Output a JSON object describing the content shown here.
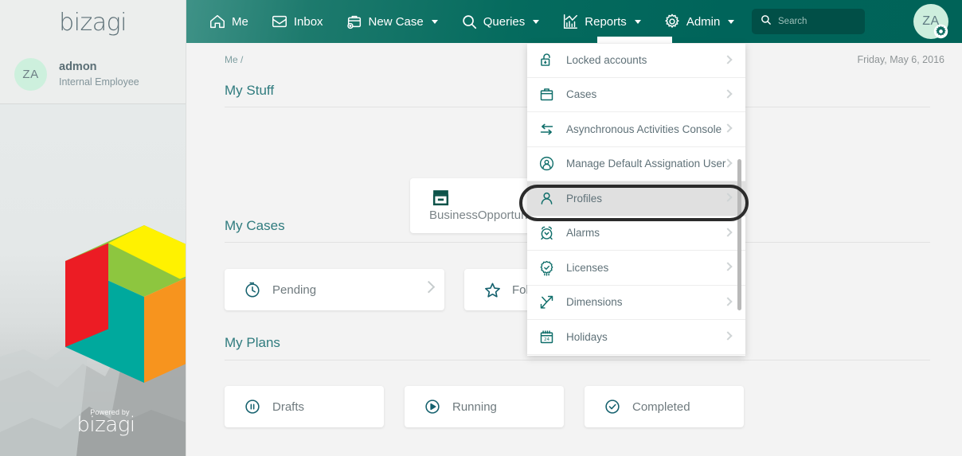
{
  "sidebar": {
    "logo_text": "bizagi",
    "user": {
      "initials": "ZA",
      "name": "admon",
      "role": "Internal Employee"
    },
    "powered_by_label": "Powered by",
    "powered_by_brand": "bizagi"
  },
  "header": {
    "nav": [
      {
        "label": "Me",
        "icon": "home-icon",
        "has_caret": false
      },
      {
        "label": "Inbox",
        "icon": "inbox-icon",
        "has_caret": false
      },
      {
        "label": "New Case",
        "icon": "briefcase-plus-icon",
        "has_caret": true
      },
      {
        "label": "Queries",
        "icon": "search-icon",
        "has_caret": true
      },
      {
        "label": "Reports",
        "icon": "chart-icon",
        "has_caret": true
      },
      {
        "label": "Admin",
        "icon": "gear-icon",
        "has_caret": true
      }
    ],
    "search": {
      "placeholder": "Search",
      "icon": "search-icon"
    },
    "avatar": {
      "initials": "ZA",
      "badge_icon": "gear-icon"
    },
    "brand_color": "#006358",
    "brand_color_light": "#3f9287"
  },
  "main": {
    "breadcrumb": "Me /",
    "date": "Friday, May 6, 2016",
    "sections": [
      {
        "title": "My Stuff"
      },
      {
        "title": "My Cases"
      },
      {
        "title": "My Plans"
      }
    ],
    "my_stuff": [
      {
        "label": "BusinessOpportunity",
        "icon": "archive-box-icon"
      }
    ],
    "my_cases": [
      {
        "label": "Pending",
        "icon": "clock-icon"
      },
      {
        "label": "Following",
        "icon": "star-icon"
      }
    ],
    "my_plans": [
      {
        "label": "Drafts",
        "icon": "pause-circle-icon"
      },
      {
        "label": "Running",
        "icon": "play-circle-icon"
      },
      {
        "label": "Completed",
        "icon": "check-circle-icon"
      }
    ]
  },
  "admin_menu": {
    "items": [
      {
        "label": "Locked accounts",
        "icon": "unlock-icon",
        "active": false
      },
      {
        "label": "Cases",
        "icon": "briefcase-icon",
        "active": false
      },
      {
        "label": "Asynchronous Activities Console",
        "icon": "swap-arrows-icon",
        "active": false
      },
      {
        "label": "Manage Default Assignation User",
        "icon": "user-circle-icon",
        "active": false
      },
      {
        "label": "Profiles",
        "icon": "user-icon",
        "active": true
      },
      {
        "label": "Alarms",
        "icon": "alarm-clock-icon",
        "active": false
      },
      {
        "label": "Licenses",
        "icon": "badge-check-icon",
        "active": false
      },
      {
        "label": "Dimensions",
        "icon": "arrows-diagonal-icon",
        "active": false
      },
      {
        "label": "Holidays",
        "icon": "calendar-icon",
        "active": false
      }
    ],
    "highlighted_item": "Profiles",
    "highlight_color": "#2b2b2b"
  }
}
